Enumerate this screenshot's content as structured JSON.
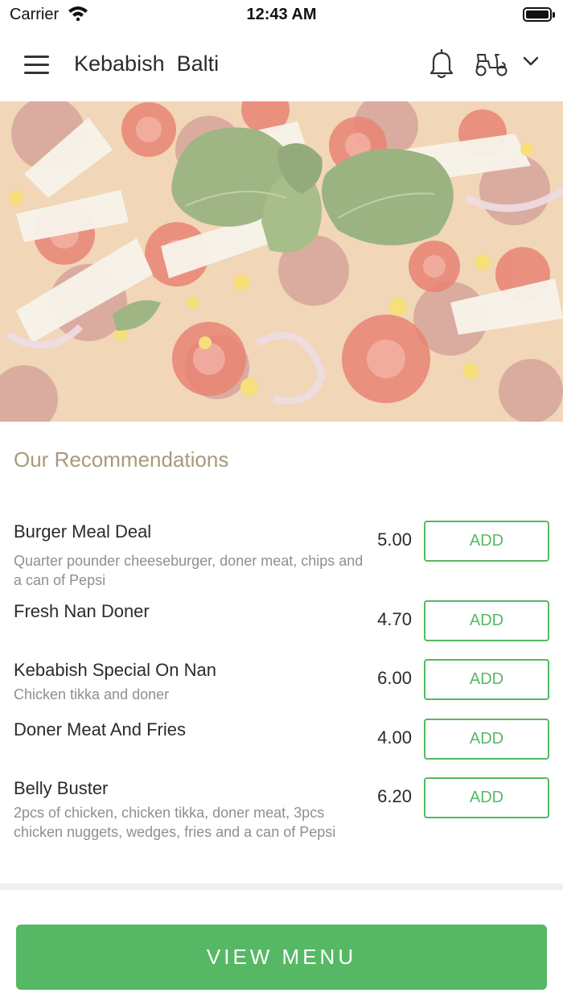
{
  "status_bar": {
    "carrier": "Carrier",
    "time": "12:43 AM"
  },
  "header": {
    "title": "Kebabish  Balti",
    "icons": [
      "menu-icon",
      "bell-icon",
      "scooter-icon",
      "chevron-down-icon"
    ]
  },
  "hero": {
    "image": "pizza-photo"
  },
  "recommendations": {
    "title": "Our Recommendations",
    "items": [
      {
        "name": "Burger Meal Deal",
        "description": "Quarter pounder cheeseburger, doner meat, chips and a can of Pepsi",
        "price": "5.00",
        "button": "ADD"
      },
      {
        "name": "Fresh Nan Doner",
        "description": "",
        "price": "4.70",
        "button": "ADD"
      },
      {
        "name": "Kebabish Special On Nan",
        "description": "Chicken tikka and doner",
        "price": "6.00",
        "button": "ADD"
      },
      {
        "name": "Doner Meat And Fries",
        "description": "",
        "price": "4.00",
        "button": "ADD"
      },
      {
        "name": "Belly Buster",
        "description": "2pcs of chicken, chicken tikka, doner meat, 3pcs chicken nuggets, wedges, fries and a can of Pepsi",
        "price": "6.20",
        "button": "ADD"
      }
    ]
  },
  "footer": {
    "view_menu_label": "VIEW MENU"
  },
  "colors": {
    "accent_green": "#56b865",
    "section_title": "#a89a7a",
    "text_primary": "#2b2b2b",
    "text_secondary": "#8f8f8f"
  }
}
